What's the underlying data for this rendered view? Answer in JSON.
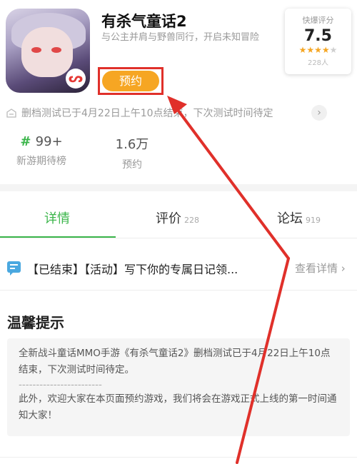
{
  "app": {
    "title": "有杀气童话2",
    "description": "与公主并肩与野兽同行，开启未知冒险",
    "reserve_label": "预约"
  },
  "score": {
    "label": "快爆评分",
    "value": "7.5",
    "stars": 4,
    "count": "228人"
  },
  "notice": {
    "text": "删档测试已于4月22日上午10点结束，下次测试时间待定"
  },
  "stats": [
    {
      "value": "99+",
      "caption": "新游期待榜"
    },
    {
      "value": "1.6万",
      "caption": "预约"
    }
  ],
  "tabs": [
    {
      "label": "详情",
      "count": ""
    },
    {
      "label": "评价",
      "count": "228"
    },
    {
      "label": "论坛",
      "count": "919"
    }
  ],
  "event": {
    "text": "【已结束】【活动】写下你的专属日记领...",
    "more": "查看详情"
  },
  "tips": {
    "title": "温馨提示",
    "para1": "全新战斗童话MMO手游《有杀气童话2》删档测试已于4月22日上午10点结束，下次测试时间待定。",
    "separator": "------------------------",
    "para2": "此外，欢迎大家在本页面预约游戏，我们将会在游戏正式上线的第一时间通知大家！"
  },
  "colors": {
    "accent_green": "#3ab54a",
    "reserve_orange": "#f6a623",
    "annotation_red": "#e0302a"
  }
}
